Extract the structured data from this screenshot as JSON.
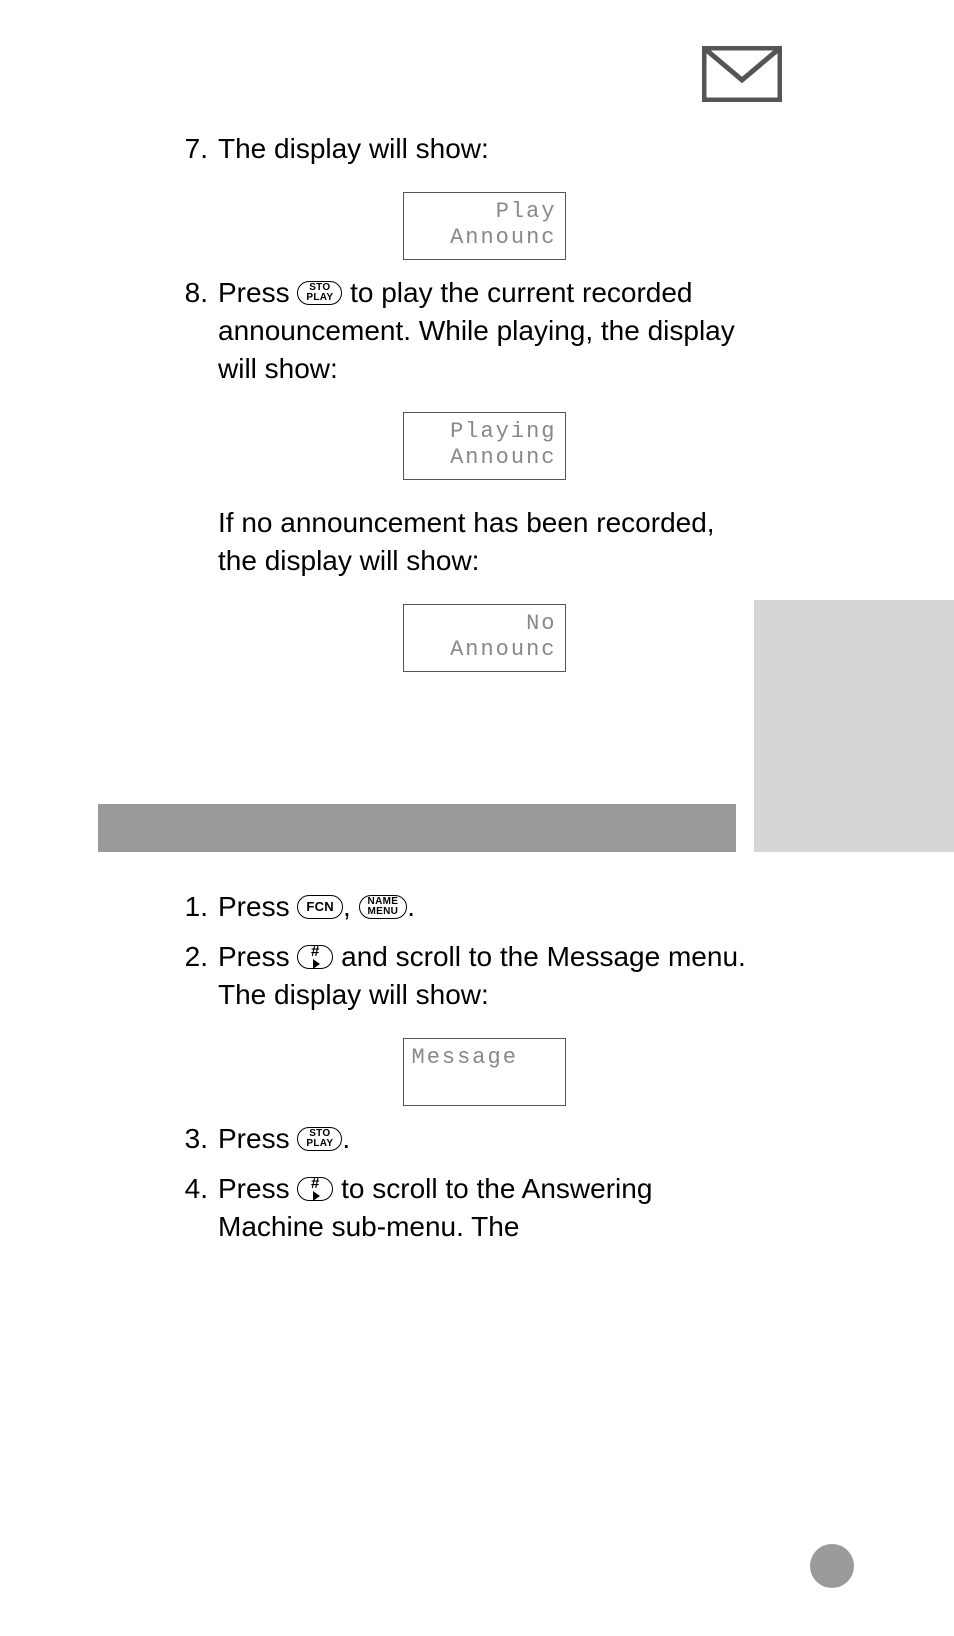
{
  "header": {
    "icon_name": "envelope-icon"
  },
  "listA": {
    "start": 7,
    "items": [
      {
        "num": "7.",
        "text_before": "The display will show:",
        "lcd": {
          "line1": "Play",
          "line2": "Announc"
        }
      },
      {
        "num": "8.",
        "text_parts": [
          "Press ",
          " to play the current recorded announcement. While playing, the display will show:"
        ],
        "key_sequence": [
          "sto_play"
        ],
        "lcd": {
          "line1": "Playing",
          "line2": "Announc"
        },
        "after_text": "If no announcement has been recorded, the display will show:",
        "lcd2": {
          "line1": "No",
          "line2": "Announc"
        }
      }
    ]
  },
  "listB": {
    "items": [
      {
        "num": "1.",
        "segments": [
          "Press ",
          ", ",
          "."
        ],
        "keys": [
          "fcn",
          "name_menu"
        ]
      },
      {
        "num": "2.",
        "segments": [
          "Press ",
          " and scroll to the Message menu. The display will show:"
        ],
        "keys": [
          "hash"
        ],
        "lcd": {
          "line1": "Message",
          "line2": " "
        }
      },
      {
        "num": "3.",
        "segments": [
          "Press ",
          "."
        ],
        "keys": [
          "sto_play"
        ]
      },
      {
        "num": "4.",
        "segments": [
          "Press ",
          " to scroll to the Answering Machine sub-menu. The"
        ],
        "keys": [
          "hash"
        ]
      }
    ]
  },
  "keys": {
    "sto_play": {
      "top": "STO",
      "bot": "PLAY"
    },
    "fcn": {
      "single": "FCN"
    },
    "name_menu": {
      "top": "NAME",
      "bot": "MENU"
    },
    "hash": {
      "single": "#"
    }
  }
}
